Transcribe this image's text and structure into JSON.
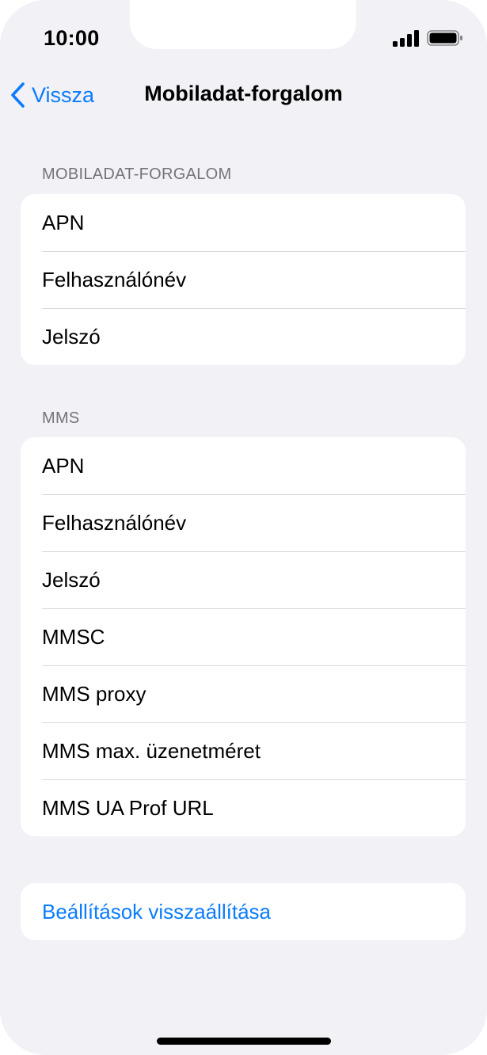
{
  "status_bar": {
    "time": "10:00"
  },
  "nav": {
    "back_label": "Vissza",
    "title": "Mobiladat-forgalom"
  },
  "sections": [
    {
      "header": "MOBILADAT-FORGALOM",
      "rows": [
        "APN",
        "Felhasználónév",
        "Jelszó"
      ]
    },
    {
      "header": "MMS",
      "rows": [
        "APN",
        "Felhasználónév",
        "Jelszó",
        "MMSC",
        "MMS proxy",
        "MMS max. üzenetméret",
        "MMS UA Prof URL"
      ]
    }
  ],
  "reset": {
    "label": "Beállítások visszaállítása"
  },
  "colors": {
    "accent": "#0a7cff",
    "background": "#f1f1f6",
    "header_text": "#737378"
  },
  "icons": {
    "back": "chevron-left-icon",
    "signal": "cellular-signal-icon",
    "battery": "battery-icon"
  }
}
